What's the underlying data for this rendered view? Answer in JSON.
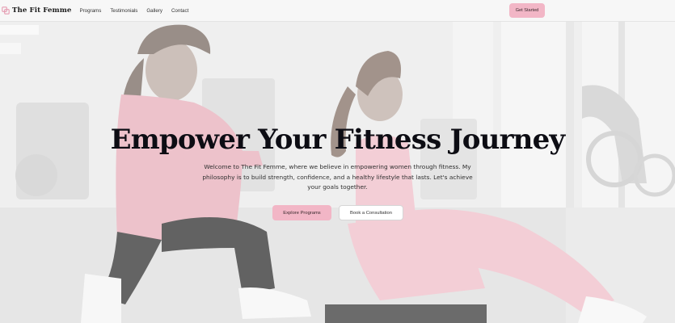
{
  "nav": {
    "brand": "The Fit Femme",
    "logo_icon": "interlocking-squares-logo",
    "links": [
      "Programs",
      "Testimonials",
      "Gallery",
      "Contact"
    ],
    "cta_label": "Get Started"
  },
  "hero": {
    "title": "Empower Your Fitness Journey",
    "description": "Welcome to The Fit Femme, where we believe in empowering women through fitness. My philosophy is to build strength, confidence, and a healthy lifestyle that lasts. Let's achieve your goals together.",
    "primary_button": "Explore Programs",
    "secondary_button": "Book a Consultation"
  },
  "colors": {
    "accent_pink": "#f2b6c6",
    "heading": "#0d0d14",
    "nav_bg": "#f7f7f7"
  }
}
